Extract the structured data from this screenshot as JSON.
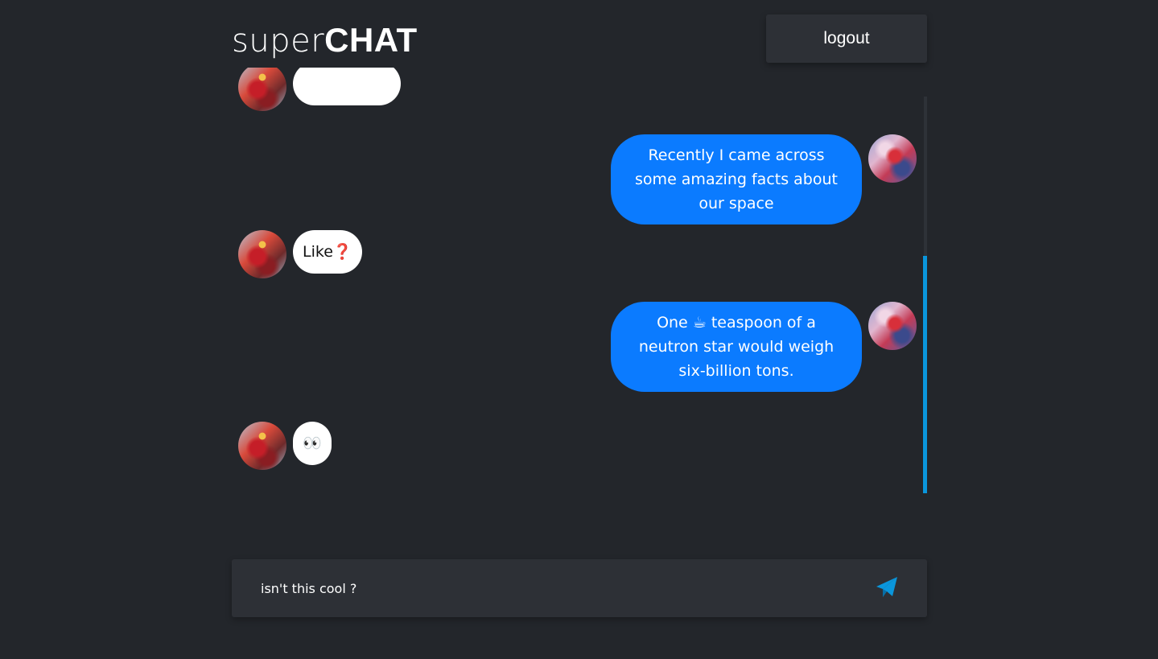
{
  "header": {
    "logo_light": "super",
    "logo_bold": "CHAT",
    "logout_label": "logout"
  },
  "messages": [
    {
      "side": "received",
      "avatar": "ironman-avatar",
      "text": ""
    },
    {
      "side": "sent",
      "avatar": "harley-avatar",
      "text": "Recently I came across some amazing facts about our space"
    },
    {
      "side": "received",
      "avatar": "ironman-avatar",
      "text": "Like❓"
    },
    {
      "side": "sent",
      "avatar": "harley-avatar",
      "text": "One ☕ teaspoon of a neutron star would weigh six-billion tons."
    },
    {
      "side": "received",
      "avatar": "ironman-avatar",
      "text": "👀"
    }
  ],
  "composer": {
    "value": "isn't this cool ?",
    "send_icon": "paper-plane-icon"
  },
  "colors": {
    "background": "#23262b",
    "panel": "#2d3036",
    "sent_bubble": "#0b7bff",
    "received_bubble": "#ffffff",
    "accent": "#0a96dc"
  }
}
